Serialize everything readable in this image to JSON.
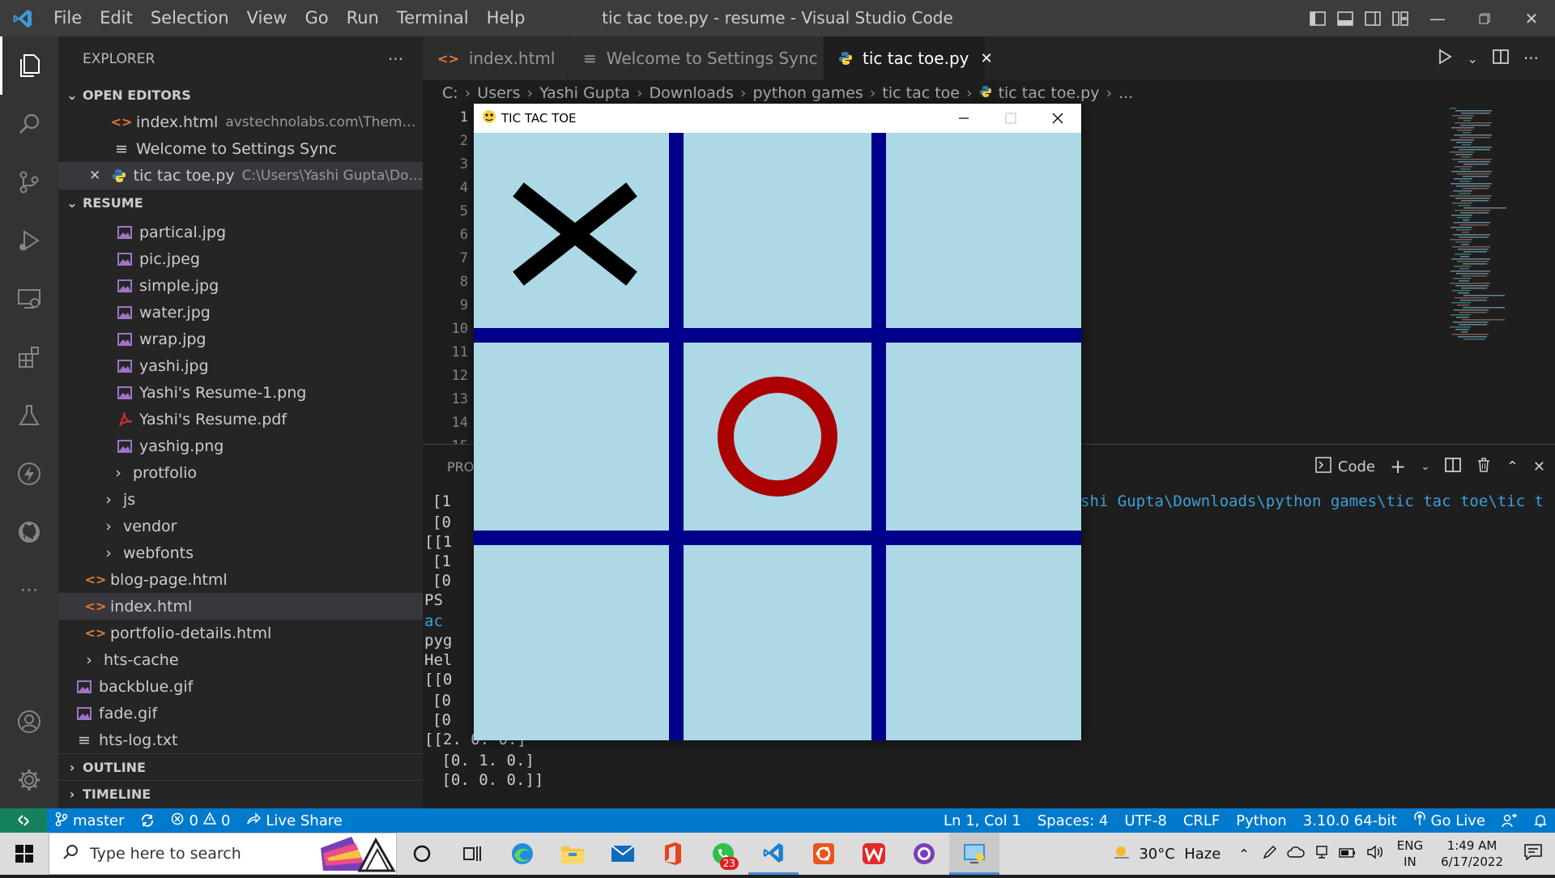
{
  "app": {
    "menu": [
      "File",
      "Edit",
      "Selection",
      "View",
      "Go",
      "Run",
      "Terminal",
      "Help"
    ],
    "window_title": "tic tac toe.py - resume - Visual Studio Code"
  },
  "explorer": {
    "title": "EXPLORER",
    "more": "···",
    "open_editors_label": "OPEN EDITORS",
    "open_editors": [
      {
        "name": "index.html",
        "desc": "avstechnolabs.com\\Themefore...",
        "icon": "html-icon"
      },
      {
        "name": "Welcome to Settings Sync",
        "desc": "",
        "icon": "lines-icon"
      },
      {
        "name": "tic tac toe.py",
        "desc": "C:\\Users\\Yashi Gupta\\Downl...",
        "icon": "python-icon"
      }
    ],
    "folder_label": "RESUME",
    "files": [
      {
        "name": "partical.jpg",
        "icon": "image-icon"
      },
      {
        "name": "pic.jpeg",
        "icon": "image-icon"
      },
      {
        "name": "simple.jpg",
        "icon": "image-icon"
      },
      {
        "name": "water.jpg",
        "icon": "image-icon"
      },
      {
        "name": "wrap.jpg",
        "icon": "image-icon"
      },
      {
        "name": "yashi.jpg",
        "icon": "image-icon"
      },
      {
        "name": "Yashi's Resume-1.png",
        "icon": "image-icon"
      },
      {
        "name": "Yashi's Resume.pdf",
        "icon": "pdf-icon"
      },
      {
        "name": "yashig.png",
        "icon": "image-icon"
      }
    ],
    "folders_a": [
      "protfolio"
    ],
    "folders_b": [
      "js",
      "vendor",
      "webfonts"
    ],
    "html_files": [
      "blog-page.html",
      "index.html",
      "portfolio-details.html"
    ],
    "root_folder": "hts-cache",
    "root_files": [
      {
        "name": "backblue.gif",
        "icon": "image-icon"
      },
      {
        "name": "fade.gif",
        "icon": "image-icon"
      },
      {
        "name": "hts-log.txt",
        "icon": "lines-icon"
      }
    ],
    "outline_label": "OUTLINE",
    "timeline_label": "TIMELINE"
  },
  "tabs": [
    {
      "label": "index.html",
      "icon": "html-icon"
    },
    {
      "label": "Welcome to Settings Sync",
      "icon": "lines-icon"
    },
    {
      "label": "tic tac toe.py",
      "icon": "python-icon"
    }
  ],
  "breadcrumb": [
    "C:",
    "Users",
    "Yashi Gupta",
    "Downloads",
    "python games",
    "tic tac toe",
    "tic tac toe.py",
    "..."
  ],
  "line_numbers": [
    "1",
    "2",
    "3",
    "4",
    "5",
    "6",
    "7",
    "8",
    "9",
    "10",
    "11",
    "12",
    "13",
    "14",
    "15"
  ],
  "panel": {
    "tab_label": "PRO",
    "shell_label": "Code",
    "terminal_left": [
      "[1",
      "[0",
      "[[1",
      "[1",
      "[0",
      "PS ",
      "ac",
      "pyg",
      "Hel",
      "[[0",
      "[0",
      "[0",
      "[[2. 0. 0.]",
      " [0. 1. 0.]",
      " [0. 0. 0.]]"
    ],
    "terminal_right": "shi Gupta\\Downloads\\python games\\tic tac toe\\tic t"
  },
  "pygame": {
    "title": "TIC TAC TOE",
    "board": [
      [
        "X",
        "",
        ""
      ],
      [
        "",
        "O",
        ""
      ],
      [
        "",
        "",
        ""
      ]
    ],
    "bg_color": "#add8e6",
    "line_color": "#00008b",
    "x_color": "#000000",
    "o_color": "#aa0000"
  },
  "status": {
    "branch": "master",
    "errors": "0",
    "warnings": "0",
    "live_share": "Live Share",
    "position": "Ln 1, Col 1",
    "spaces": "Spaces: 4",
    "encoding": "UTF-8",
    "eol": "CRLF",
    "language": "Python",
    "interpreter": "3.10.0 64-bit",
    "go_live": "Go Live"
  },
  "taskbar": {
    "search_placeholder": "Type here to search",
    "weather": "30°C  Haze",
    "lang1": "ENG",
    "lang2": "IN",
    "time": "1:49 AM",
    "date": "6/17/2022",
    "whatsapp_badge": "23"
  }
}
